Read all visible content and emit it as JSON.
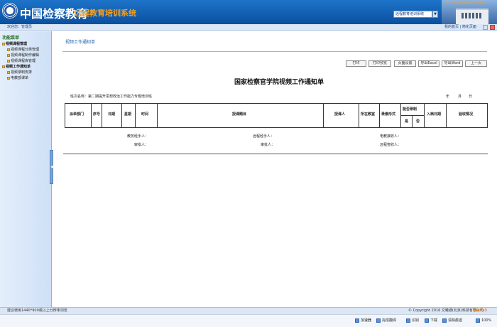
{
  "header": {
    "brand": "中国检察教育",
    "subtitle": "远程教育培训系统",
    "system_select": "远程教育培训系统",
    "building_caption": "中华人民共和国最高人民检察院"
  },
  "topbar": {
    "welcome": "欢迎您：管理员",
    "my_home": "我的首页",
    "switch_version": "简化页面"
  },
  "sidebar": {
    "title": "功能菜单",
    "groups": [
      {
        "label": "视频课程管理",
        "items": [
          "视频课程分类管理",
          "视频课程制作编辑",
          "视频课程库管理"
        ]
      },
      {
        "label": "视频工作通知单",
        "items": [
          "视频录制安排",
          "电教部课单"
        ]
      }
    ]
  },
  "main": {
    "title": "视频工作通知单",
    "buttons": [
      "打印",
      "打印预览",
      "页面设置",
      "导出Excel",
      "导出Word",
      "上一页"
    ],
    "doc_title": "国家检察官学院视频工作通知单",
    "class_name": "班次名称：第二期提升思想政治工作能力专题培训班",
    "date": {
      "year": "年",
      "month": "月",
      "day": "日"
    },
    "table": {
      "headers": [
        "派单部门",
        "序号",
        "日期",
        "星期",
        "时间",
        "授课题目",
        "授课人",
        "所在教室",
        "录像形式",
        "能否录制",
        "是",
        "否",
        "入档日期",
        "验收情况"
      ]
    },
    "signatures": {
      "row1": [
        "教务经手人：",
        "远程经手人：",
        "电教接收人："
      ],
      "row2": [
        "审批人：",
        "审批人：",
        "远程签收人："
      ]
    }
  },
  "footer": {
    "left": "建议使用1440*900或以上分辨率浏览",
    "copyright": "© Copyright 2016 文曦通(北京)科技有限公司",
    "logo": "Webx3"
  },
  "taskbar": {
    "items": [
      "加速器",
      "完成翻译",
      "识别",
      "下载",
      "清除痕迹",
      "100%"
    ]
  }
}
